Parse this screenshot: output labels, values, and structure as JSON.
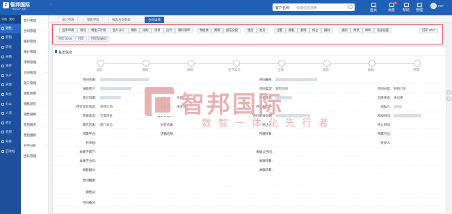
{
  "topbar": {
    "brand": "智邦国际",
    "brand_sub": "一体化ERP 系统",
    "search_select": "客户名称",
    "search_placeholder": "快捷信息搜索",
    "items": [
      "首页",
      "消息",
      "帮助",
      "管理"
    ],
    "message_count": "2",
    "user": "ERP"
  },
  "sidebar": {
    "header": [
      "导航",
      "我的"
    ],
    "items": [
      "销售",
      "营销",
      "研发",
      "采购",
      "库存",
      "生产",
      "质量",
      "财务",
      "办公",
      "人资",
      "统计",
      "客服",
      "系统",
      "回收站"
    ],
    "active_index": 0
  },
  "submenu": {
    "items": [
      "客户管理",
      "合同管理",
      "报检管理",
      "报价管理",
      "项目管理",
      "合同管理",
      "施工管理",
      "销售费用",
      "销售退货",
      "销售替换",
      "售后服务",
      "售后维修",
      "对手分析",
      "团队管理"
    ]
  },
  "tabs": {
    "items": [
      "设计列表",
      "销售存款",
      "报表合同列表",
      "合同详情"
    ],
    "active_index": 3
  },
  "toolbar": {
    "row1": [
      "出库申请",
      "领况",
      "预生产计划",
      "生产派工",
      "预购",
      "采购",
      "项目",
      "设计",
      "物料清单",
      "预收款",
      "费用",
      "提成分配",
      "售后",
      "退货",
      "出售",
      "模板",
      "复制",
      "终止",
      "删除",
      "通知",
      "共享",
      "邮件",
      "发送设置",
      "打印 2017"
    ],
    "row2": [
      "打印 2016",
      "打印",
      "打印记录(0)"
    ]
  },
  "card": {
    "title": "基本信息",
    "steps": [
      "设计",
      "预购",
      "采购",
      "生产派工",
      "出库",
      "发货",
      "收款",
      "开票"
    ]
  },
  "form": {
    "rows": [
      {
        "l1": "合同主题:",
        "l3": "合同编号:"
      },
      {
        "l1": "关联客户:",
        "l2": "",
        "l3": "合同类型:",
        "v3": "销售合同",
        "l4": "合同分类:",
        "v4": "购销订单"
      },
      {
        "l1": "签订日期:",
        "l2": "销售人员:",
        "v2": "风景",
        "l3": "审批状态:",
        "v3": "",
        "l4": "出库状态:",
        "v4": "未出库"
      },
      {
        "l1": "预计交付状态:",
        "v1": "待预计划",
        "l2": "发货状态:",
        "v2": "未发货",
        "l3": "开票执行中:",
        "l4": "添加人:"
      },
      {
        "l1": "审批状态:",
        "v1": "无需审批",
        "l2": "当前审批人:",
        "v2": "",
        "l3": "合同有效日期:",
        "l4": "添加时间:"
      },
      {
        "l1": "我方代表:",
        "v1": "部门状态",
        "l2": "对方代表:",
        "v2": "",
        "l3": "终止人:",
        "l4": "终止时间:"
      },
      {
        "l1": "所属平台:",
        "l2": "店铺名称:",
        "l3": "所属项目:",
        "l4": "所属行业:"
      },
      {
        "l1": "共享给:",
        "l4": "共享人:"
      },
      {
        "l1": "关联子客户:",
        "l3": "关联父合同:"
      },
      {
        "l1": "关联子合同:",
        "l3": "关联项目:"
      },
      {
        "l1": "关联报价:",
        "l3": "关联项目:"
      },
      {
        "l1": "合同概要:"
      },
      {
        "l1": "销售员:"
      },
      {
        "l1": "合同备注:"
      }
    ]
  },
  "watermark": {
    "name": "智邦国际",
    "slogan": "数智一体化先行者"
  },
  "colors": {
    "primary": "#1f5fb5",
    "sidebar": "#1d4f9a",
    "toolbar_border": "#e55",
    "watermark": "#e6a9a9"
  }
}
